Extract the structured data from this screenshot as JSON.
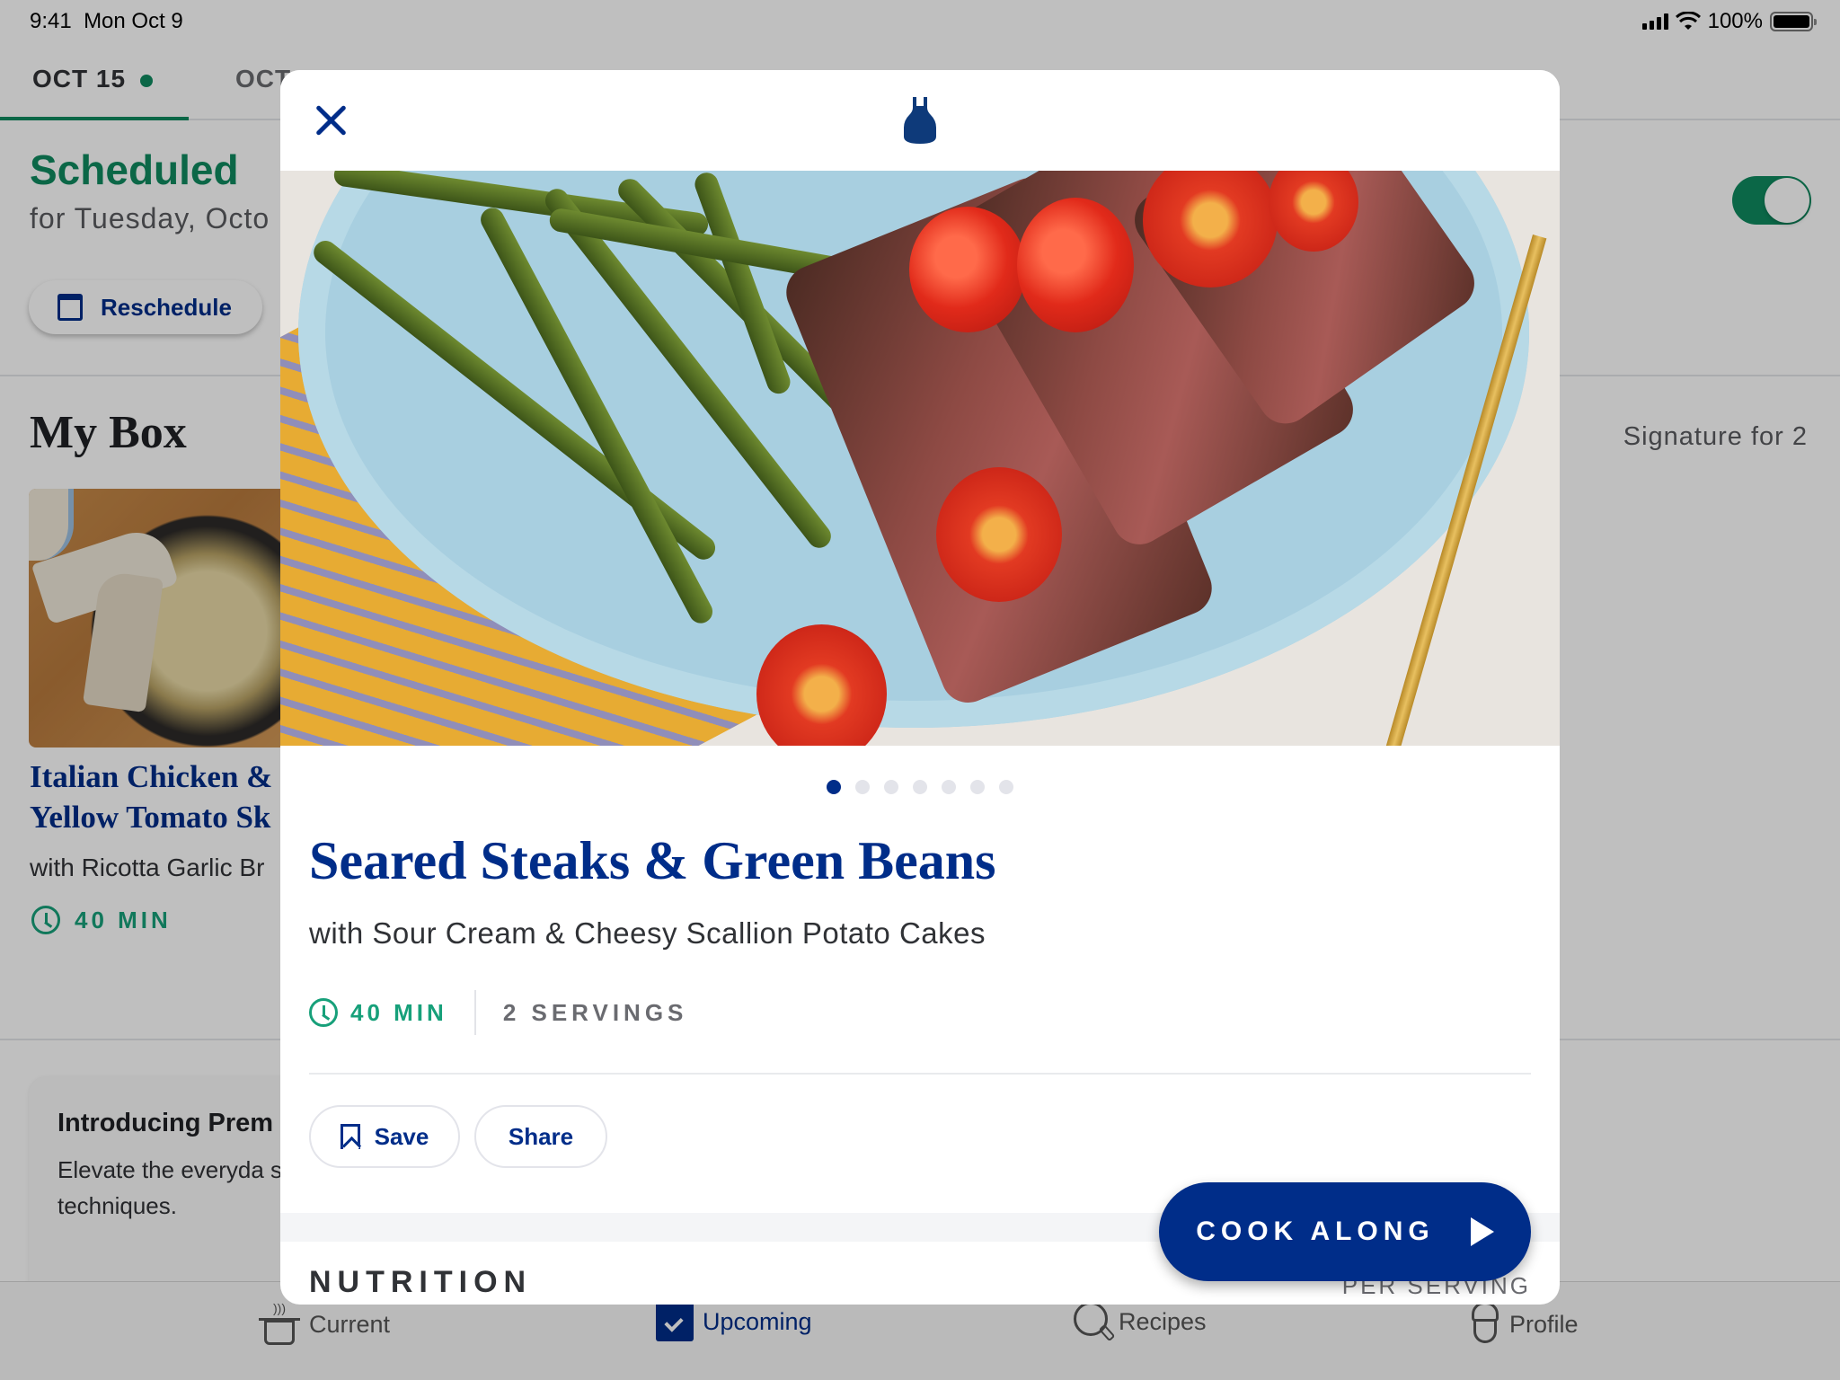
{
  "status_bar": {
    "time": "9:41",
    "date": "Mon Oct 9",
    "battery": "100%",
    "battery_level": 1.0
  },
  "date_tabs": [
    {
      "label": "OCT 15",
      "active": true,
      "has_dot": true
    },
    {
      "label": "OCT",
      "active": false
    }
  ],
  "schedule": {
    "status": "Scheduled",
    "subtitle": "for Tuesday, Octo",
    "reschedule_label": "Reschedule",
    "toggle_on": true
  },
  "my_box": {
    "title": "My Box",
    "plan": "Signature for 2",
    "card": {
      "title_line1": "Italian Chicken &",
      "title_line2": "Yellow Tomato Sk",
      "subtitle": "with Ricotta Garlic Br",
      "time": "40 MIN"
    }
  },
  "promo": {
    "title": "Introducing Prem",
    "body": "Elevate the everyda specialty ingredien new techniques."
  },
  "tab_bar": [
    {
      "label": "Current",
      "icon": "pot-icon",
      "active": false
    },
    {
      "label": "Upcoming",
      "icon": "calendar-check-icon",
      "active": true
    },
    {
      "label": "Recipes",
      "icon": "search-icon",
      "active": false
    },
    {
      "label": "Profile",
      "icon": "chef-icon",
      "active": false
    }
  ],
  "modal": {
    "logo": "apron-logo",
    "carousel": {
      "count": 7,
      "active_index": 0
    },
    "recipe": {
      "title": "Seared Steaks & Green Beans",
      "subtitle": "with Sour Cream & Cheesy Scallion Potato Cakes",
      "time": "40 MIN",
      "servings": "2 SERVINGS"
    },
    "actions": {
      "save_label": "Save",
      "share_label": "Share"
    },
    "cook_along_label": "COOK ALONG",
    "nutrition": {
      "heading": "NUTRITION",
      "per_serving": "PER SERVING"
    }
  },
  "colors": {
    "brand_blue": "#002d89",
    "green": "#0f8a5f",
    "teal_time": "#17a07a"
  }
}
